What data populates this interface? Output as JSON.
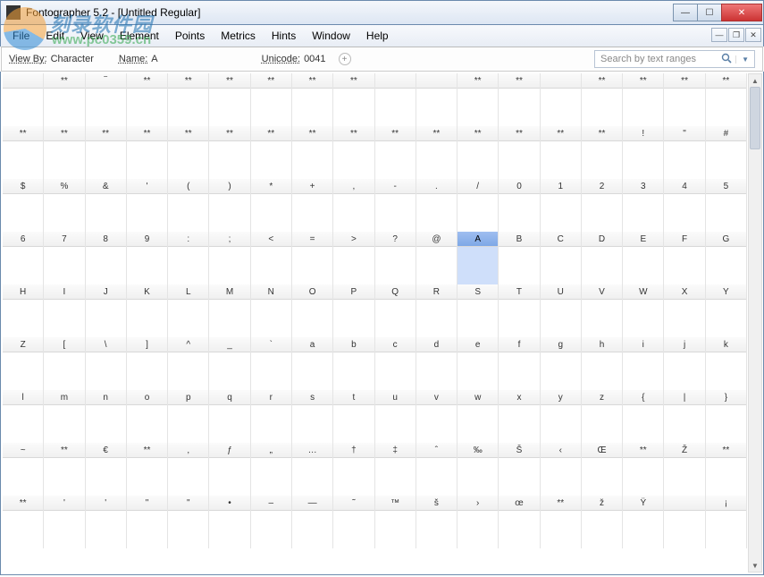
{
  "window": {
    "title": "Fontographer 5.2 - [Untitled Regular]",
    "min_icon": "—",
    "max_icon": "☐",
    "close_icon": "✕"
  },
  "menu": {
    "items": [
      "File",
      "Edit",
      "View",
      "Element",
      "Points",
      "Metrics",
      "Hints",
      "Window",
      "Help"
    ]
  },
  "mdi": {
    "min": "—",
    "restore": "❐",
    "close": "✕"
  },
  "watermark": {
    "line1": "刻录软件园",
    "line2": "www.pc0359.cn"
  },
  "infobar": {
    "viewby_label": "View By:",
    "viewby_value": "Character",
    "name_label": "Name:",
    "name_value": "A",
    "unicode_label": "Unicode:",
    "unicode_value": "0041",
    "add_glyph": "+",
    "search_placeholder": "Search by text ranges",
    "search_dropdown": "▼"
  },
  "grid": {
    "cols": 18,
    "rows": [
      [
        "",
        "**",
        "‾",
        "**",
        "**",
        "**",
        "**",
        "**",
        "**",
        "",
        "",
        "**",
        "**",
        "",
        "**",
        "**",
        "**",
        "**"
      ],
      [
        "**",
        "**",
        "**",
        "**",
        "**",
        "**",
        "**",
        "**",
        "**",
        "**",
        "**",
        "**",
        "**",
        "**",
        "**",
        "!",
        "\"",
        "#"
      ],
      [
        "$",
        "%",
        "&",
        "'",
        "(",
        ")",
        "*",
        "+",
        ",",
        "-",
        ".",
        "/",
        "0",
        "1",
        "2",
        "3",
        "4",
        "5"
      ],
      [
        "6",
        "7",
        "8",
        "9",
        ":",
        ";",
        "<",
        "=",
        ">",
        "?",
        "@",
        "A",
        "B",
        "C",
        "D",
        "E",
        "F",
        "G"
      ],
      [
        "H",
        "I",
        "J",
        "K",
        "L",
        "M",
        "N",
        "O",
        "P",
        "Q",
        "R",
        "S",
        "T",
        "U",
        "V",
        "W",
        "X",
        "Y"
      ],
      [
        "Z",
        "[",
        "\\",
        "]",
        "^",
        "_",
        "`",
        "a",
        "b",
        "c",
        "d",
        "e",
        "f",
        "g",
        "h",
        "i",
        "j",
        "k"
      ],
      [
        "l",
        "m",
        "n",
        "o",
        "p",
        "q",
        "r",
        "s",
        "t",
        "u",
        "v",
        "w",
        "x",
        "y",
        "z",
        "{",
        "|",
        "}"
      ],
      [
        "~",
        "**",
        "€",
        "**",
        "‚",
        "ƒ",
        "„",
        "…",
        "†",
        "‡",
        "ˆ",
        "‰",
        "Š",
        "‹",
        "Œ",
        "**",
        "Ž",
        "**"
      ],
      [
        "**",
        "'",
        "'",
        "\"",
        "\"",
        "•",
        "–",
        "—",
        "˜",
        "™",
        "š",
        "›",
        "œ",
        "**",
        "ž",
        "Ÿ",
        "",
        "¡"
      ]
    ],
    "selected": {
      "row": 3,
      "col": 11
    }
  }
}
